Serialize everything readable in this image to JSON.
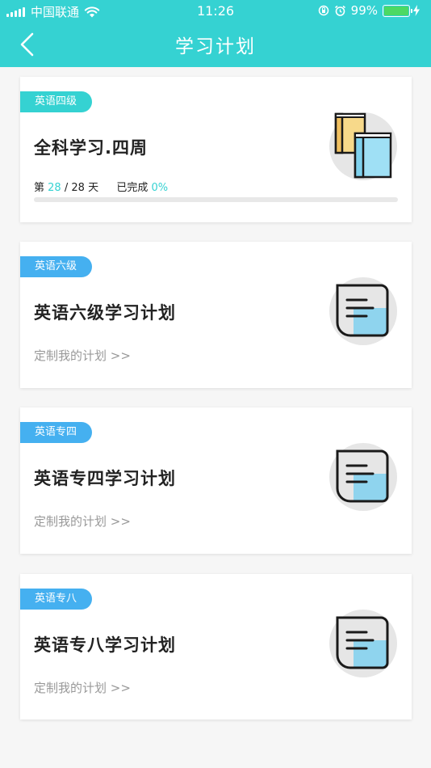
{
  "status_bar": {
    "carrier": "中国联通",
    "time": "11:26",
    "battery": "99%",
    "battery_level": 0.99
  },
  "nav": {
    "title": "学习计划",
    "back_icon": "chevron-left-icon"
  },
  "plans": [
    {
      "tag": "英语四级",
      "title": "全科学习.四周",
      "icon": "books-icon",
      "progress": {
        "day_prefix": "第",
        "current_day": "28",
        "separator": "/",
        "total_days": "28",
        "day_suffix": "天",
        "completed_label": "已完成",
        "completed_pct": "0%",
        "fraction": 0
      }
    },
    {
      "tag": "英语六级",
      "title": "英语六级学习计划",
      "link": "定制我的计划 >>",
      "icon": "document-icon"
    },
    {
      "tag": "英语专四",
      "title": "英语专四学习计划",
      "link": "定制我的计划 >>",
      "icon": "document-icon"
    },
    {
      "tag": "英语专八",
      "title": "英语专八学习计划",
      "link": "定制我的计划 >>",
      "icon": "document-icon"
    }
  ],
  "colors": {
    "primary": "#35d2d2",
    "tag_blue": "#45b0f0",
    "battery_green": "#4cd964"
  }
}
